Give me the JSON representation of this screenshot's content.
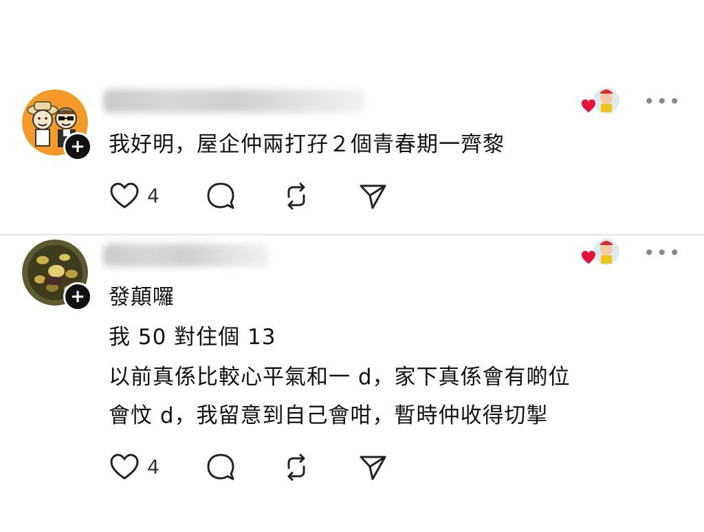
{
  "comments": [
    {
      "text": "我好明，屋企仲兩打孖２個青春期一齊黎",
      "likes": "4"
    },
    {
      "lines": [
        "發顛囉",
        "我 50 對住個 13",
        "以前真係比較心平氣和一 d，家下真係會有啲位",
        "會忟 d，我留意到自己會咁，暫時仲收得切掣"
      ],
      "likes": "4"
    }
  ],
  "colors": {
    "heart_badge": "#e8113b",
    "avatar1_bg": "#f39a2b",
    "avatar2_bg": "#5c5a2e",
    "follow_button": "#111111"
  },
  "icons": [
    "heart-icon",
    "comment-icon",
    "repost-icon",
    "share-icon",
    "more-icon",
    "plus-icon"
  ]
}
